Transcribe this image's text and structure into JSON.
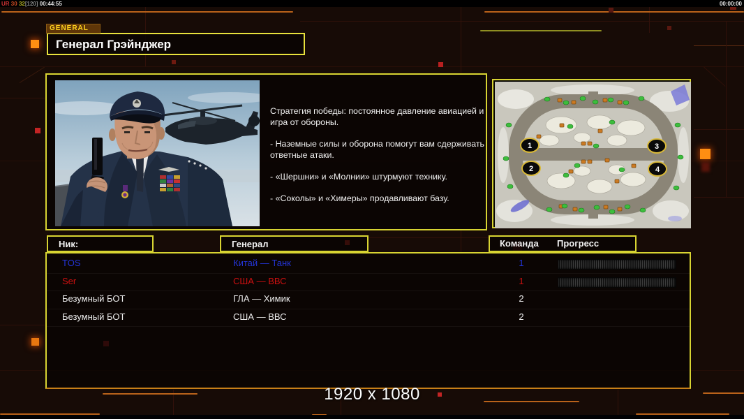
{
  "top_bar": {
    "debug": {
      "ur": "UR",
      "fps": "30",
      "ms": "32",
      "cap": "[120]",
      "time": "00:44:55"
    },
    "clock": "00:00:00"
  },
  "tab_label": "GENERAL",
  "title": "Генерал Грэйнджер",
  "strategy": {
    "paragraphs": [
      "Стратегия победы: постоянное давление авиацией и игра от обороны.",
      "- Наземные силы и оборона помогут вам сдерживать ответные атаки.",
      "- «Шершни» и «Молнии» штурмуют технику.",
      "- «Соколы» и «Химеры» продавливают базу."
    ]
  },
  "minimap": {
    "positions": [
      "1",
      "2",
      "3",
      "4"
    ]
  },
  "table": {
    "headers": {
      "nick": "Ник:",
      "general": "Генерал",
      "team": "Команда",
      "progress": "Прогресс"
    },
    "rows": [
      {
        "nick": "TOS",
        "general": "Китай — Танк",
        "team": "1",
        "color": "#2435d8",
        "has_progress": true
      },
      {
        "nick": "Ser",
        "general": "США — ВВС",
        "team": "1",
        "color": "#cc1010",
        "has_progress": true
      },
      {
        "nick": "Безумный БОТ",
        "general": "ГЛА — Химик",
        "team": "2",
        "color": "#ececec",
        "has_progress": false
      },
      {
        "nick": "Безумный БОТ",
        "general": "США — ВВС",
        "team": "2",
        "color": "#ececec",
        "has_progress": false
      }
    ]
  },
  "footer_resolution": "1920 x 1080",
  "colors": {
    "panel_border": "#d8d432",
    "tab_bg": "#5f3608",
    "tab_text": "#ffd21e",
    "accent_orange": "#b9621a",
    "row_blue": "#2435d8",
    "row_red": "#cc1010",
    "row_white": "#ececec",
    "debug_ur": "#cc3333",
    "debug_fps": "#cc4a22",
    "debug_ms": "#aaaa22",
    "debug_cap": "#888888"
  }
}
